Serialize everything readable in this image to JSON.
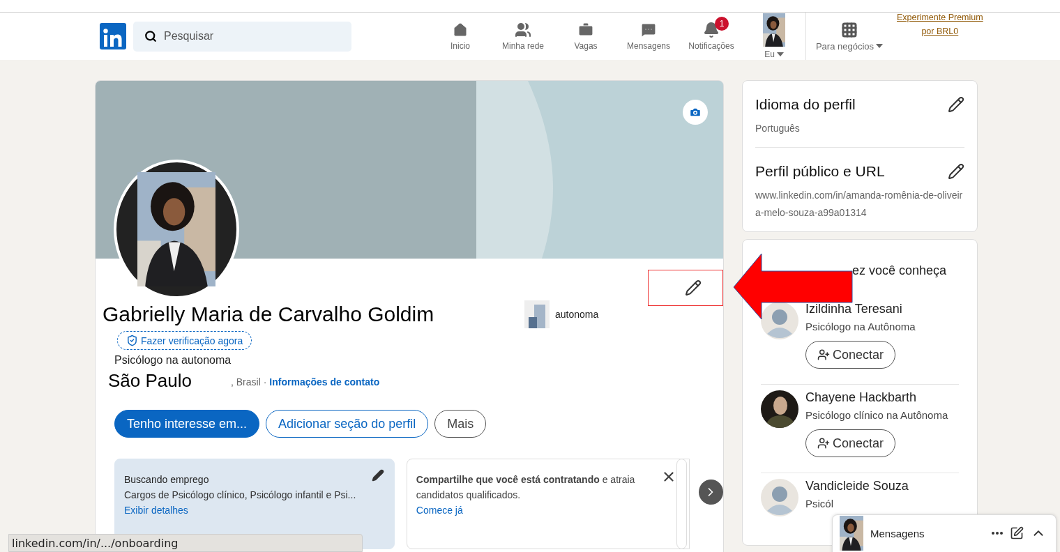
{
  "nav": {
    "search_placeholder": "Pesquisar",
    "items": [
      {
        "kind": "home",
        "label": "Inicio"
      },
      {
        "kind": "network",
        "label": "Minha rede"
      },
      {
        "kind": "jobs",
        "label": "Vagas"
      },
      {
        "kind": "messages",
        "label": "Mensagens"
      },
      {
        "kind": "notifications",
        "label": "Notificações",
        "badge": "1"
      }
    ],
    "me": "Eu",
    "business": "Para negócios",
    "premium": [
      "Experimente Premium",
      "por BRL0"
    ]
  },
  "profile": {
    "name": "Gabrielly Maria de Carvalho Goldim",
    "verify": "Fazer verificação agora",
    "headline": "Psicólogo na autonoma",
    "city": "São Paulo",
    "country": ", Brasil ·",
    "contact": "Informações de contato",
    "company": "autonoma",
    "buttons": [
      {
        "label": "Tenho interesse em...",
        "kind": "primary"
      },
      {
        "label": "Adicionar seção do perfil",
        "kind": "outline"
      },
      {
        "label": "Mais",
        "kind": "neutral"
      }
    ],
    "cards": [
      {
        "kind": "edit",
        "title": "Buscando emprego",
        "text": "Cargos de Psicólogo clínico, Psicólogo infantil e Psi...",
        "link": "Exibir detalhes"
      },
      {
        "kind": "close",
        "text": "**Compartilhe que você está contratando** e atraia candidatos qualificados.",
        "link": "Comece já"
      }
    ]
  },
  "sidebar": {
    "sections": [
      {
        "title": "Idioma do perfil",
        "value": "Português"
      },
      {
        "title": "Perfil público e URL",
        "value": "www.linkedin.com/in/amanda-romênia-de-oliveira-melo-souza-a99a01314"
      }
    ],
    "people_heading": "ez você conheça",
    "people": [
      {
        "name": "Izildinha Teresani",
        "headline": "Psicólogo na Autônoma",
        "button": "Conectar",
        "kind": "placeholder"
      },
      {
        "name": "Chayene Hackbarth",
        "headline": "Psicólogo clínico na Autônoma",
        "button": "Conectar"
      },
      {
        "name": "Vandicleide Souza",
        "headline": "Psicól",
        "kind": "placeholder"
      }
    ]
  },
  "messaging": {
    "title": "Mensagens"
  },
  "status_url": "linkedin.com/in/.../onboarding"
}
